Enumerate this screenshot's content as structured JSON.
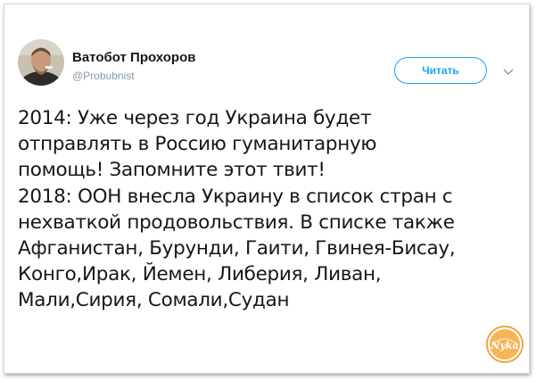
{
  "author": {
    "name": "Ватобот Прохоров",
    "handle": "@Probubnist"
  },
  "actions": {
    "follow_label": "Читать",
    "menu_icon": "chevron-down-icon"
  },
  "tweet": {
    "lines": [
      "2014: Уже через год Украина будет",
      "отправлять в Россию гуманитарную",
      "помощь! Запомните этот твит!",
      "2018: ООН внесла Украину в список стран с",
      "нехваткой продовольствия. В списке также",
      "Афганистан, Бурунди, Гаити, Гвинея-Бисау,",
      "Конго,Ирак, Йемен, Либерия, Ливан,",
      "Мали,Сирия, Сомали,Судан"
    ]
  },
  "watermark": {
    "text": "Nyka"
  },
  "colors": {
    "accent": "#1da1f2",
    "text": "#14171a",
    "muted": "#8899a6",
    "watermark": "#f0a640"
  }
}
